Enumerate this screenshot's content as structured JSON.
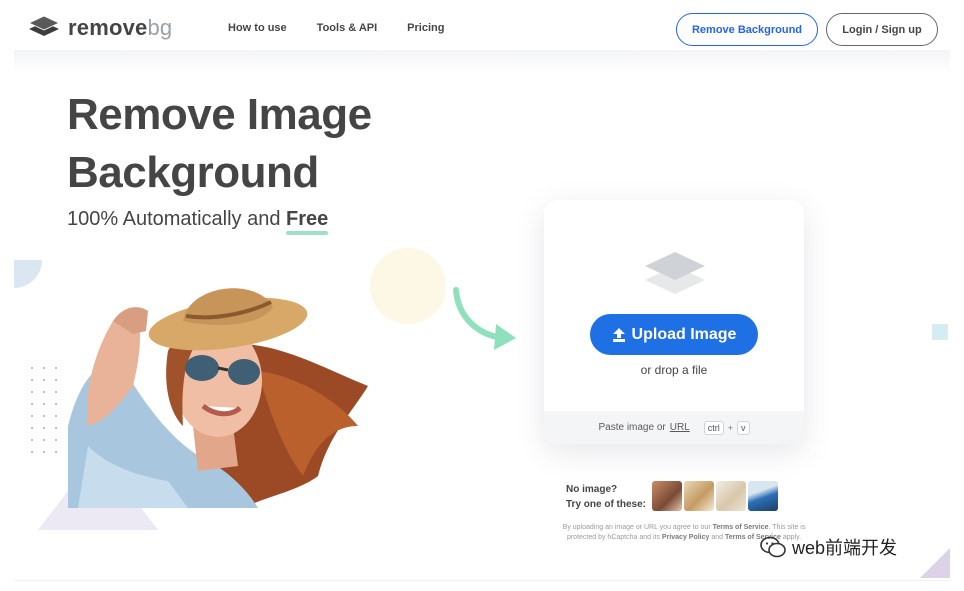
{
  "header": {
    "logo": {
      "text_main": "remove",
      "text_bg": "bg"
    },
    "nav": [
      {
        "label": "How to use"
      },
      {
        "label": "Tools & API"
      },
      {
        "label": "Pricing"
      }
    ],
    "remove_background_label": "Remove Background",
    "login_label": "Login / Sign up"
  },
  "hero": {
    "title_line1": "Remove Image",
    "title_line2": "Background",
    "subtitle_prefix": "100% Automatically and ",
    "subtitle_emphasis": "Free"
  },
  "upload_card": {
    "button_label": "Upload Image",
    "drop_text": "or drop a file",
    "paste_text": "Paste image or",
    "paste_url": "URL",
    "kbd_ctrl": "ctrl",
    "kbd_plus": "+",
    "kbd_v": "v"
  },
  "samples": {
    "line1": "No image?",
    "line2": "Try one of these:"
  },
  "legal": {
    "part1": "By uploading an image or URL you agree to our",
    "terms": "Terms of Service",
    "part2": ". This site is protected by hCaptcha and its",
    "privacy": "Privacy Policy",
    "part3": "and",
    "terms2": "Terms of Service",
    "part4": "apply."
  },
  "watermark": {
    "text": "web前端开发"
  },
  "colors": {
    "accent_blue": "#1f6fe5",
    "text_dark": "#454545",
    "free_underline": "#9fdfc4",
    "arrow_green": "#8fe0bd"
  },
  "icons": [
    "logo-layers-icon",
    "card-layers-icon",
    "upload-arrow-icon",
    "curved-arrow-icon",
    "wechat-icon"
  ]
}
